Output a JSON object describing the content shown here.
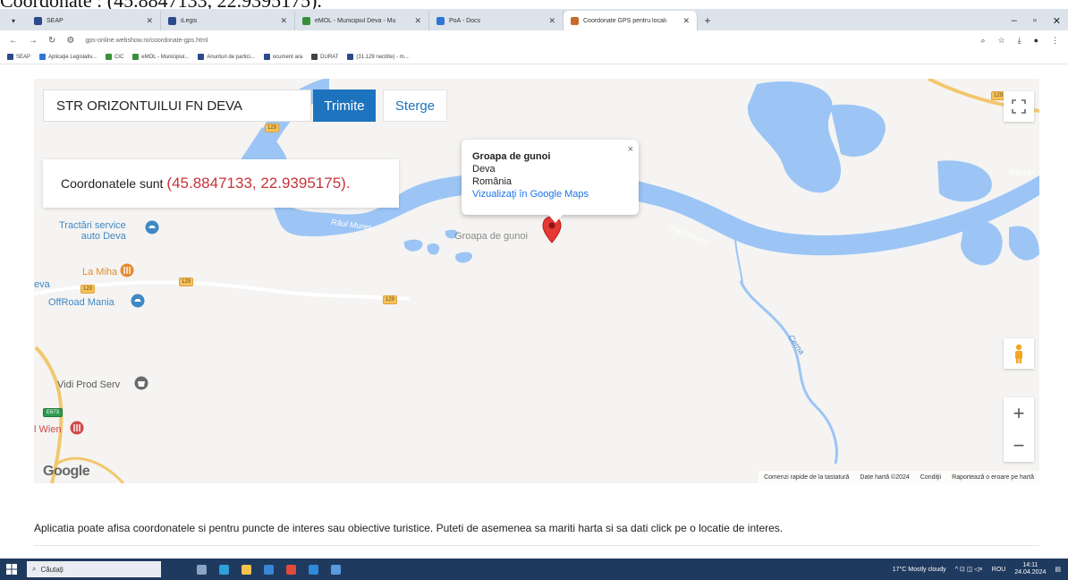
{
  "caption": "Coordonate : (45.8847133, 22.9395175).",
  "browser": {
    "tabs": [
      {
        "title": "SEAP",
        "color": "#2b4a8b"
      },
      {
        "title": "iLegis",
        "color": "#2b4a8b"
      },
      {
        "title": "eMOL - Municipiul Deva - Mu",
        "color": "#3a8f3a"
      },
      {
        "title": "PoA - Docs",
        "color": "#2e75d6"
      },
      {
        "title": "Coordonate GPS pentru locali",
        "color": "#c56b2b"
      }
    ],
    "new_tab": "+",
    "url": "gps-online.webshow.ro/coordonate-gps.html",
    "bookmarks": [
      {
        "label": "SEAP",
        "color": "#2b4a8b"
      },
      {
        "label": "Aplicaţie Legislativ...",
        "color": "#2e75d6"
      },
      {
        "label": "CIC",
        "color": "#3a8f3a"
      },
      {
        "label": "eMOL - Municipiul...",
        "color": "#3a8f3a"
      },
      {
        "label": "Anunturi de partici...",
        "color": "#2b4a8b"
      },
      {
        "label": "ocument ara",
        "color": "#2b4a8b"
      },
      {
        "label": "DURAT",
        "color": "#444444"
      },
      {
        "label": "(31.129 necitite) - m...",
        "color": "#2b4a8b"
      }
    ]
  },
  "map": {
    "search_value": "STR ORIZONTUILUI FN DEVA",
    "send_label": "Trimite",
    "clear_label": "Sterge",
    "coord_prefix": "Coordonatele sunt",
    "coord_value": "(45.8847133, 22.9395175).",
    "info": {
      "title": "Groapa de gunoi",
      "line1": "Deva",
      "line2": "România",
      "link": "Vizualizaţi în Google Maps",
      "close": "×"
    },
    "marker_label": "Groapa de gunoi",
    "river_labels": [
      "Râul Mureş",
      "Râul Mureş",
      "Râul M",
      "Cerna"
    ],
    "pois": [
      {
        "line1": "Tractări service",
        "line2": "auto Deva",
        "color": "#3f88c5"
      },
      {
        "line1": "La Miha",
        "line2": "",
        "color": "#e58a2c"
      },
      {
        "line1": "OffRoad Mania",
        "line2": "",
        "color": "#3f88c5"
      },
      {
        "line1": "Vidi Prod Serv",
        "line2": "",
        "color": "#5a5a5a"
      },
      {
        "line1": "l Wien",
        "line2": "",
        "color": "#d04a4a"
      }
    ],
    "place_text": "eva",
    "road_numbers": [
      "129",
      "129",
      "129",
      "129",
      "129",
      "E673"
    ],
    "footer": [
      "Comenzi rapide de la tastatură",
      "Date hartă ©2024",
      "Condiţii",
      "Raportează o eroare pe hartă"
    ],
    "logo": "Google",
    "zoom_in": "+",
    "zoom_out": "−",
    "colors": {
      "water": "#9cc5f5",
      "button": "#1e73be",
      "coord": "#c8333b",
      "road": "#f6c35b",
      "marker": "#e53935"
    }
  },
  "page": {
    "description": "Aplicatia poate afisa coordonatele si pentru puncte de interes sau obiective turistice. Puteti de asemenea sa mariti harta si sa dati click pe o locatie de interes."
  },
  "taskbar": {
    "search_placeholder": "Căutați",
    "weather": "17°C Mostly cloudy",
    "lang": "ROU",
    "time": "14:11",
    "date": "24.04.2024"
  }
}
